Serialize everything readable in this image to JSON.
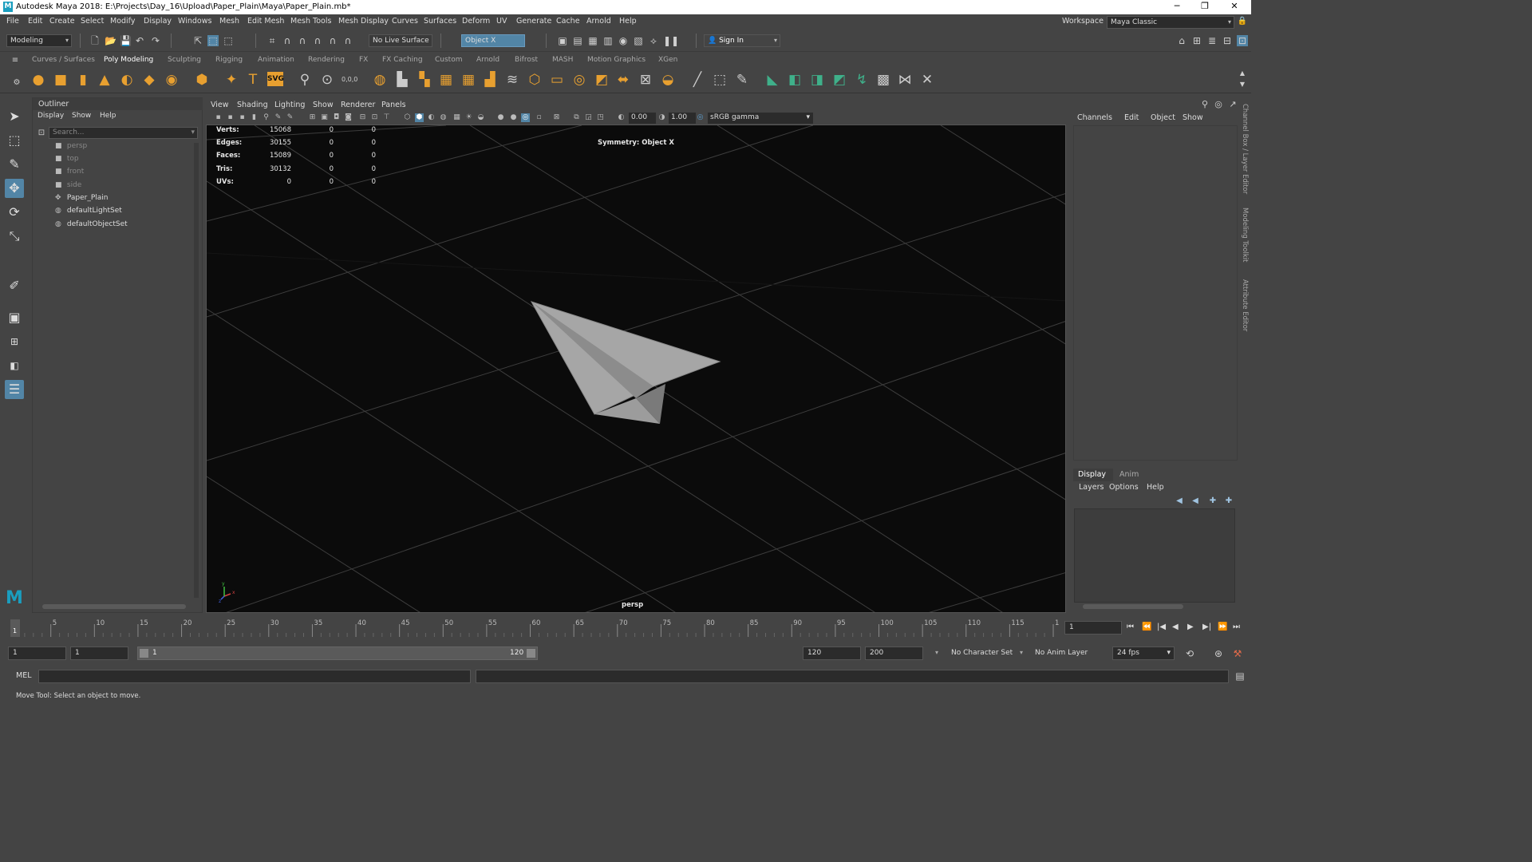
{
  "window": {
    "title": "Autodesk Maya 2018: E:\\Projects\\Day_16\\Upload\\Paper_Plain\\Maya\\Paper_Plain.mb*",
    "logo": "M",
    "controls": [
      "─",
      "❐",
      "✕"
    ]
  },
  "menubar": {
    "items": [
      "File",
      "Edit",
      "Create",
      "Select",
      "Modify",
      "Display",
      "Windows",
      "Mesh",
      "Edit Mesh",
      "Mesh Tools",
      "Mesh Display",
      "Curves",
      "Surfaces",
      "Deform",
      "UV",
      "Generate",
      "Cache",
      "Arnold",
      "Help"
    ],
    "workspace_label": "Workspace :",
    "workspace_value": "Maya Classic"
  },
  "statusline": {
    "menuset": "Modeling",
    "live_surface": "No Live Surface",
    "symmetry": "Object X",
    "sign_in": "Sign In"
  },
  "shelf": {
    "tabs": [
      "Curves / Surfaces",
      "Poly Modeling",
      "Sculpting",
      "Rigging",
      "Animation",
      "Rendering",
      "FX",
      "FX Caching",
      "Custom",
      "Arnold",
      "Bifrost",
      "MASH",
      "Motion Graphics",
      "XGen"
    ],
    "active_tab": "Poly Modeling",
    "svg_label": "SVG",
    "text_label": "T",
    "coord_label": "0,0,0"
  },
  "outliner": {
    "title": "Outliner",
    "menu": [
      "Display",
      "Show",
      "Help"
    ],
    "search_placeholder": "Search...",
    "items": [
      {
        "label": "persp",
        "type": "camera"
      },
      {
        "label": "top",
        "type": "camera"
      },
      {
        "label": "front",
        "type": "camera"
      },
      {
        "label": "side",
        "type": "camera"
      },
      {
        "label": "Paper_Plain",
        "type": "mesh"
      },
      {
        "label": "defaultLightSet",
        "type": "set"
      },
      {
        "label": "defaultObjectSet",
        "type": "set"
      }
    ]
  },
  "viewport": {
    "menu": [
      "View",
      "Shading",
      "Lighting",
      "Show",
      "Renderer",
      "Panels"
    ],
    "exposure": "0.00",
    "gamma": "1.00",
    "color_space": "sRGB gamma",
    "camera": "persp",
    "symmetry_hud": "Symmetry: Object X",
    "hud": [
      {
        "label": "Verts:",
        "values": [
          "15068",
          "0",
          "0"
        ]
      },
      {
        "label": "Edges:",
        "values": [
          "30155",
          "0",
          "0"
        ]
      },
      {
        "label": "Faces:",
        "values": [
          "15089",
          "0",
          "0"
        ]
      },
      {
        "label": "Tris:",
        "values": [
          "30132",
          "0",
          "0"
        ]
      },
      {
        "label": "UVs:",
        "values": [
          "0",
          "0",
          "0"
        ]
      }
    ],
    "axis_labels": [
      "x",
      "y",
      "z"
    ]
  },
  "channelbox": {
    "menu": [
      "Channels",
      "Edit",
      "Object",
      "Show"
    ]
  },
  "layereditor": {
    "tabs": [
      "Display",
      "Anim"
    ],
    "menu": [
      "Layers",
      "Options",
      "Help"
    ]
  },
  "side_tabs": [
    "Channel Box / Layer Editor",
    "Modeling Toolkit",
    "Attribute Editor"
  ],
  "timeline": {
    "ticks": [
      "1",
      "5",
      "10",
      "15",
      "20",
      "25",
      "30",
      "35",
      "40",
      "45",
      "50",
      "55",
      "60",
      "65",
      "70",
      "75",
      "80",
      "85",
      "90",
      "95",
      "100",
      "105",
      "110",
      "115",
      "120"
    ],
    "current_frame": "1",
    "playback_buttons": [
      "⏮",
      "⏪",
      "|◀",
      "◀",
      "▶",
      "▶|",
      "⏩",
      "⏭"
    ]
  },
  "range": {
    "start": "1",
    "playback_start": "1",
    "slider_start": "1",
    "slider_end": "120",
    "playback_end": "120",
    "end": "200",
    "character_set": "No Character Set",
    "anim_layer": "No Anim Layer",
    "fps": "24 fps"
  },
  "cmdline": {
    "label": "MEL"
  },
  "helpline": {
    "text": "Move Tool: Select an object to move."
  },
  "colors": {
    "accent": "#5285a6",
    "viewport_bg": "#0b0b0b",
    "maya_logo": "#1a9ebf",
    "shelf_orange": "#e8a030",
    "shelf_green": "#3fb08a"
  }
}
